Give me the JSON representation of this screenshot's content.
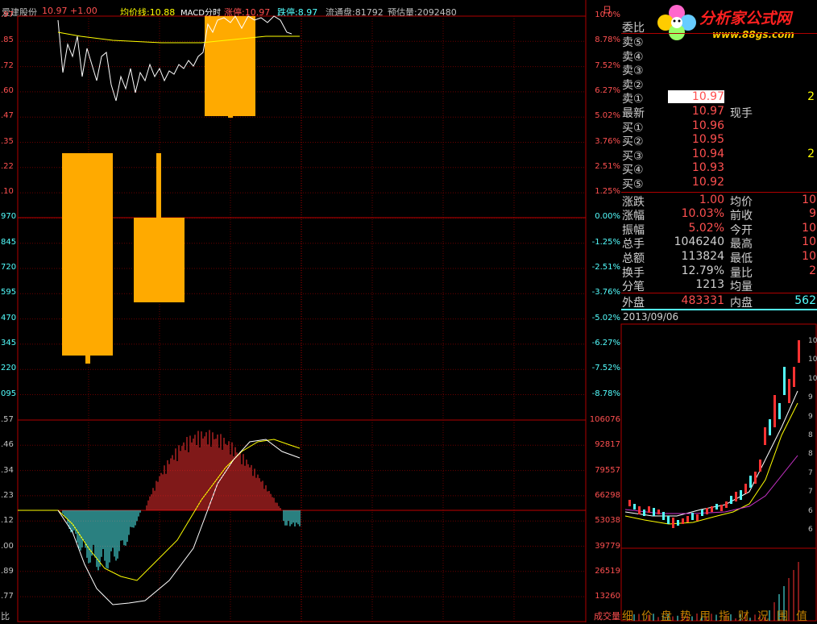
{
  "header": {
    "stock_name": "爱建股份",
    "price_change": "10.97 +1.00",
    "avg_line": "均价线:10.88",
    "indicator": "MACD分时",
    "limit_up": "涨停:10.97",
    "limit_down": "跌停:8.97",
    "float_shares": "流通盘:81792",
    "estimated_vol": "预估量:2092480",
    "corner_tab": "日"
  },
  "price_axis_left": [
    ".97",
    ".85",
    ".72",
    ".60",
    ".47",
    ".35",
    ".22",
    ".10",
    "970",
    "845",
    "720",
    "595",
    "470",
    "345",
    "220",
    "095"
  ],
  "price_axis_right": [
    "10.0%",
    "8.78%",
    "7.52%",
    "6.27%",
    "5.02%",
    "3.76%",
    "2.51%",
    "1.25%",
    "0.00%",
    "-1.25%",
    "-2.51%",
    "-3.76%",
    "-5.02%",
    "-6.27%",
    "-7.52%",
    "-8.78%"
  ],
  "macd_axis_left": [
    ".57",
    ".46",
    ".34",
    ".23",
    ".12",
    ".00",
    ".89",
    ".77"
  ],
  "macd_axis_right": [
    "106076",
    "92817",
    "79557",
    "66298",
    "53038",
    "39779",
    "26519",
    "13260"
  ],
  "bottom_left_label": "比",
  "bottom_right_label": "成交量",
  "logo": {
    "text": "分析家公式网",
    "url": "www.88gs.com"
  },
  "quote": {
    "title": "委比",
    "sells": [
      {
        "label": "卖⑤",
        "price": "",
        "vol": ""
      },
      {
        "label": "卖④",
        "price": "",
        "vol": ""
      },
      {
        "label": "卖③",
        "price": "",
        "vol": ""
      },
      {
        "label": "卖②",
        "price": "",
        "vol": ""
      },
      {
        "label": "卖①",
        "price": "10.97",
        "vol": "2"
      }
    ],
    "latest": {
      "label": "最新",
      "price": "10.97",
      "extra": "现手"
    },
    "buys": [
      {
        "label": "买①",
        "price": "10.96",
        "vol": ""
      },
      {
        "label": "买②",
        "price": "10.95",
        "vol": ""
      },
      {
        "label": "买③",
        "price": "10.94",
        "vol": "2"
      },
      {
        "label": "买④",
        "price": "10.93",
        "vol": ""
      },
      {
        "label": "买⑤",
        "price": "10.92",
        "vol": ""
      }
    ],
    "stats": [
      {
        "k1": "涨跌",
        "v1": "1.00",
        "k2": "均价",
        "v2": "10"
      },
      {
        "k1": "涨幅",
        "v1": "10.03%",
        "k2": "前收",
        "v2": "9"
      },
      {
        "k1": "振幅",
        "v1": "5.02%",
        "k2": "今开",
        "v2": "10"
      },
      {
        "k1": "总手",
        "v1": "1046240",
        "k2": "最高",
        "v2": "10"
      },
      {
        "k1": "总额",
        "v1": "113824",
        "k2": "最低",
        "v2": "10"
      },
      {
        "k1": "换手",
        "v1": "12.79%",
        "k2": "量比",
        "v2": "2"
      },
      {
        "k1": "分笔",
        "v1": "1213",
        "k2": "均量",
        "v2": ""
      }
    ],
    "outer": {
      "k1": "外盘",
      "v1": "483331",
      "k2": "内盘",
      "v2": "562"
    }
  },
  "date": "2013/09/06",
  "mini_axis": [
    "10",
    "10",
    "10",
    "9",
    "9",
    "8",
    "8",
    "7",
    "7",
    "6",
    "6"
  ],
  "bottom_tabs": [
    "细",
    "价",
    "盘",
    "势",
    "用",
    "指",
    "财",
    "况",
    "围",
    "值"
  ],
  "colors": {
    "bg": "#000000",
    "frame": "#b00000",
    "grid": "#6a0000",
    "up": "#ff3232",
    "down": "#54ffff",
    "candle": "#ffaa00",
    "price_line": "#ffffff",
    "avg_line": "#ffff00",
    "label_cyan": "#7fd4ff"
  }
}
